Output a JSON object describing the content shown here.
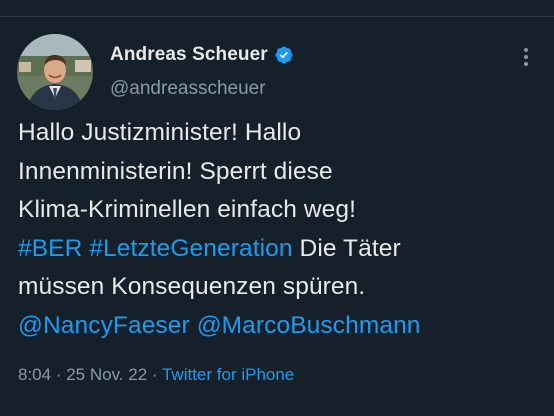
{
  "author": {
    "name": "Andreas Scheuer",
    "handle": "@andreasscheuer"
  },
  "tweet": {
    "line1": "Hallo Justizminister! Hallo",
    "line2": "Innenministerin! Sperrt diese",
    "line3": "Klima-Kriminellen einfach weg!",
    "hashtag1": "#BER",
    "hashtag2": "#LetzteGeneration",
    "line4_rest": " Die Täter",
    "line5": "müssen Konsequenzen spüren.",
    "mention1": "@NancyFaeser",
    "mention2": "@MarcoBuschmann"
  },
  "meta": {
    "time": "8:04",
    "separator1": " · ",
    "date": "25 Nov. 22",
    "separator2": " · ",
    "source": "Twitter for iPhone"
  },
  "colors": {
    "background": "#15202b",
    "link": "#1d9bf0",
    "text": "#e7e9ea",
    "secondary": "#8b98a5"
  },
  "icons": {
    "verified": "verified-badge-icon",
    "more": "more-options-icon"
  }
}
